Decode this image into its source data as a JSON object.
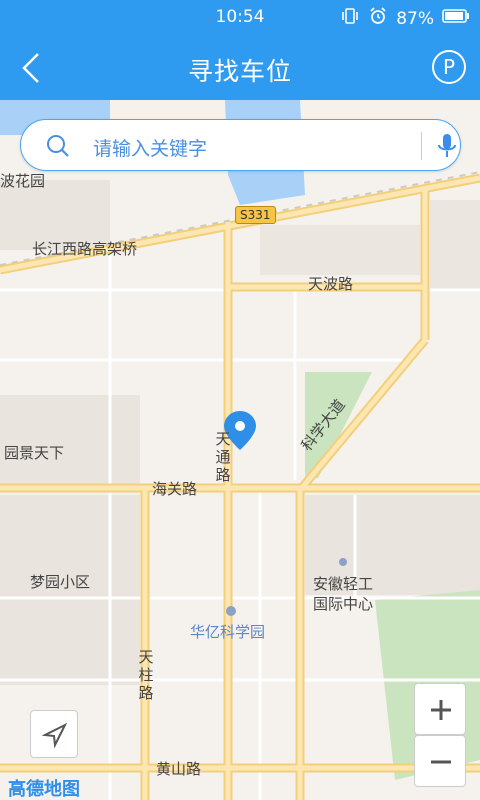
{
  "status": {
    "time": "10:54",
    "battery": "87%"
  },
  "header": {
    "title": "寻找车位",
    "parking_label": "P"
  },
  "search": {
    "placeholder": "请输入关键字"
  },
  "map": {
    "labels": {
      "top_left_area": "波花园",
      "road_changjiang": "长江西路高架桥",
      "road_tianbo": "天波路",
      "road_tiantong": "天通路",
      "road_haiguan": "海关路",
      "road_kexue": "科学大道",
      "area_yuanjing": "园景天下",
      "area_mengyuan": "梦园小区",
      "poi_anhui_1": "安徽轻工",
      "poi_anhui_2": "国际中心",
      "poi_huayi": "华亿科学园",
      "road_tianzhu": "天柱路",
      "road_huangshan": "黄山路",
      "highway_badge": "S331"
    },
    "colors": {
      "road": "#f8d98a",
      "water": "#a9d1f7",
      "green": "#c9e4bf",
      "land": "#f5f2ed",
      "block": "#e9e4dd"
    }
  },
  "controls": {
    "zoom_in": "+",
    "zoom_out": "−"
  },
  "logo": "高德地图"
}
